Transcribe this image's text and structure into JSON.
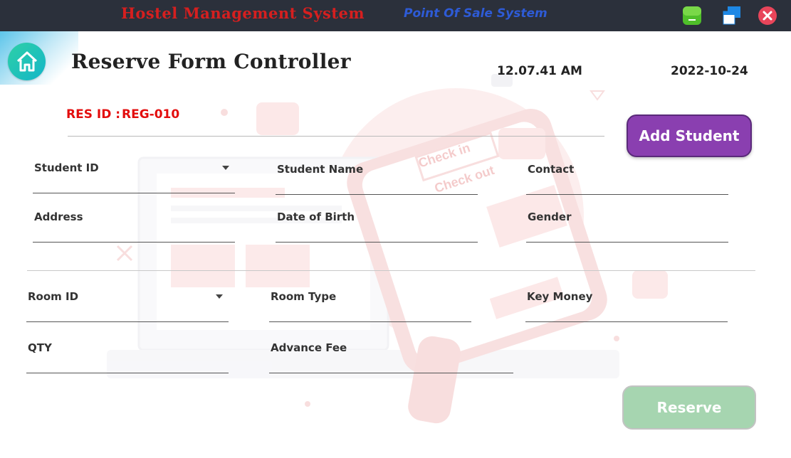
{
  "window": {
    "app_title": "Hostel Management System",
    "app_subtitle": "Point Of Sale System",
    "minimize_icon": "minimize-icon",
    "maximize_icon": "maximize-icon",
    "close_icon": "close-icon"
  },
  "header": {
    "home_icon": "home-icon",
    "title": "Reserve Form Controller",
    "time": "12.07.41 AM",
    "date": "2022-10-24"
  },
  "reservation": {
    "id_label": "RES ID :",
    "id_value": "REG-010"
  },
  "student_section": {
    "student_id": {
      "label": "Student ID",
      "value": ""
    },
    "student_name": {
      "label": "Student Name",
      "value": ""
    },
    "contact": {
      "label": "Contact",
      "value": ""
    },
    "address": {
      "label": "Address",
      "value": ""
    },
    "dob": {
      "label": "Date of Birth",
      "value": ""
    },
    "gender": {
      "label": "Gender",
      "value": ""
    }
  },
  "room_section": {
    "room_id": {
      "label": "Room ID",
      "value": ""
    },
    "room_type": {
      "label": "Room Type",
      "value": ""
    },
    "key_money": {
      "label": "Key Money",
      "value": ""
    },
    "qty": {
      "label": "QTY",
      "value": ""
    },
    "advance_fee": {
      "label": "Advance Fee",
      "value": ""
    }
  },
  "actions": {
    "add_student": "Add Student",
    "reserve": "Reserve"
  },
  "background_art": {
    "check_in": "Check in",
    "check_out": "Check out"
  },
  "colors": {
    "titlebar": "#2b303b",
    "accent_purple": "#8a3fb0",
    "reserve_green": "#a6d5b0",
    "res_id_red": "#e30d0d"
  }
}
